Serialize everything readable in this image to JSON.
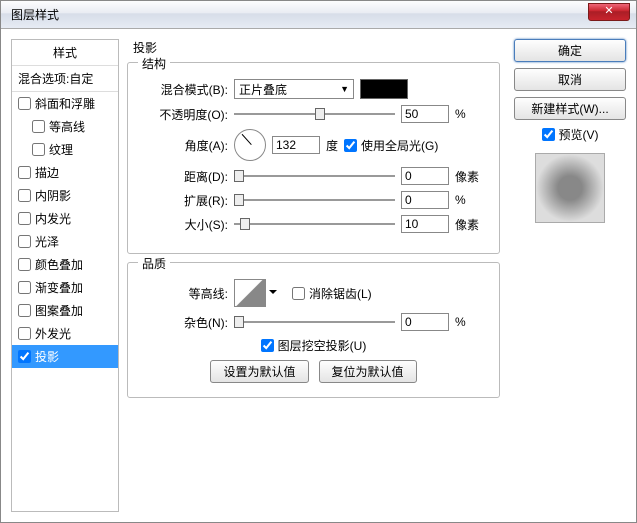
{
  "title": "图层样式",
  "sidebar": {
    "header": "样式",
    "blend": "混合选项:自定",
    "items": [
      {
        "label": "斜面和浮雕",
        "checked": false,
        "indent": false
      },
      {
        "label": "等高线",
        "checked": false,
        "indent": true
      },
      {
        "label": "纹理",
        "checked": false,
        "indent": true
      },
      {
        "label": "描边",
        "checked": false,
        "indent": false
      },
      {
        "label": "内阴影",
        "checked": false,
        "indent": false
      },
      {
        "label": "内发光",
        "checked": false,
        "indent": false
      },
      {
        "label": "光泽",
        "checked": false,
        "indent": false
      },
      {
        "label": "颜色叠加",
        "checked": false,
        "indent": false
      },
      {
        "label": "渐变叠加",
        "checked": false,
        "indent": false
      },
      {
        "label": "图案叠加",
        "checked": false,
        "indent": false
      },
      {
        "label": "外发光",
        "checked": false,
        "indent": false
      },
      {
        "label": "投影",
        "checked": true,
        "indent": false,
        "selected": true
      }
    ]
  },
  "main_title": "投影",
  "structure": {
    "title": "结构",
    "blend_mode_label": "混合模式(B):",
    "blend_mode_value": "正片叠底",
    "color": "#000000",
    "opacity_label": "不透明度(O):",
    "opacity_value": "50",
    "opacity_unit": "%",
    "opacity_pos": "50%",
    "angle_label": "角度(A):",
    "angle_value": "132",
    "angle_unit": "度",
    "global_light_label": "使用全局光(G)",
    "global_light_checked": true,
    "distance_label": "距离(D):",
    "distance_value": "0",
    "distance_unit": "像素",
    "distance_pos": "0%",
    "spread_label": "扩展(R):",
    "spread_value": "0",
    "spread_unit": "%",
    "spread_pos": "0%",
    "size_label": "大小(S):",
    "size_value": "10",
    "size_unit": "像素",
    "size_pos": "4%"
  },
  "quality": {
    "title": "品质",
    "contour_label": "等高线:",
    "antialias_label": "消除锯齿(L)",
    "antialias_checked": false,
    "noise_label": "杂色(N):",
    "noise_value": "0",
    "noise_unit": "%",
    "noise_pos": "0%"
  },
  "knockout_label": "图层挖空投影(U)",
  "knockout_checked": true,
  "default_btn": "设置为默认值",
  "reset_btn": "复位为默认值",
  "right": {
    "ok": "确定",
    "cancel": "取消",
    "newstyle": "新建样式(W)...",
    "preview_label": "预览(V)",
    "preview_checked": true
  }
}
